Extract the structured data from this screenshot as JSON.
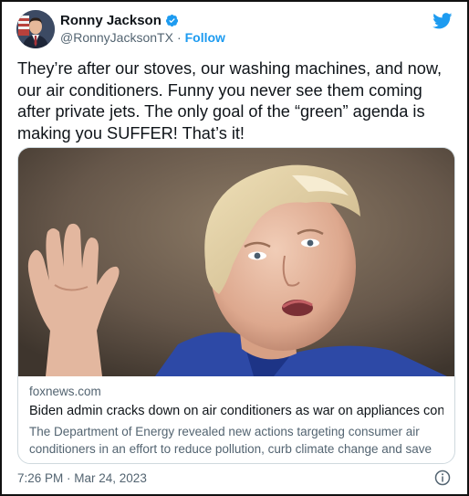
{
  "author": {
    "name": "Ronny Jackson",
    "handle": "@RonnyJacksonTX",
    "separator": "·",
    "follow_label": "Follow"
  },
  "tweet": {
    "text": "They’re after our stoves, our washing machines, and now, our air conditioners. Funny you never see them coming after private jets. The only goal of the “green” agenda is making you SUFFER! That’s it!"
  },
  "card": {
    "domain": "foxnews.com",
    "title": "Biden admin cracks down on air conditioners as war on appliances continues",
    "description": "The Department of Energy revealed new actions targeting consumer air conditioners in an effort to reduce pollution, curb climate change and save …"
  },
  "timestamp": "7:26 PM · Mar 24, 2023",
  "icons": {
    "verified": "verified-badge-icon",
    "platform": "twitter-bird-icon",
    "info": "info-icon"
  },
  "colors": {
    "accent": "#1d9bf0",
    "text": "#0f1419",
    "secondary": "#536471",
    "border": "#cfd9de"
  }
}
